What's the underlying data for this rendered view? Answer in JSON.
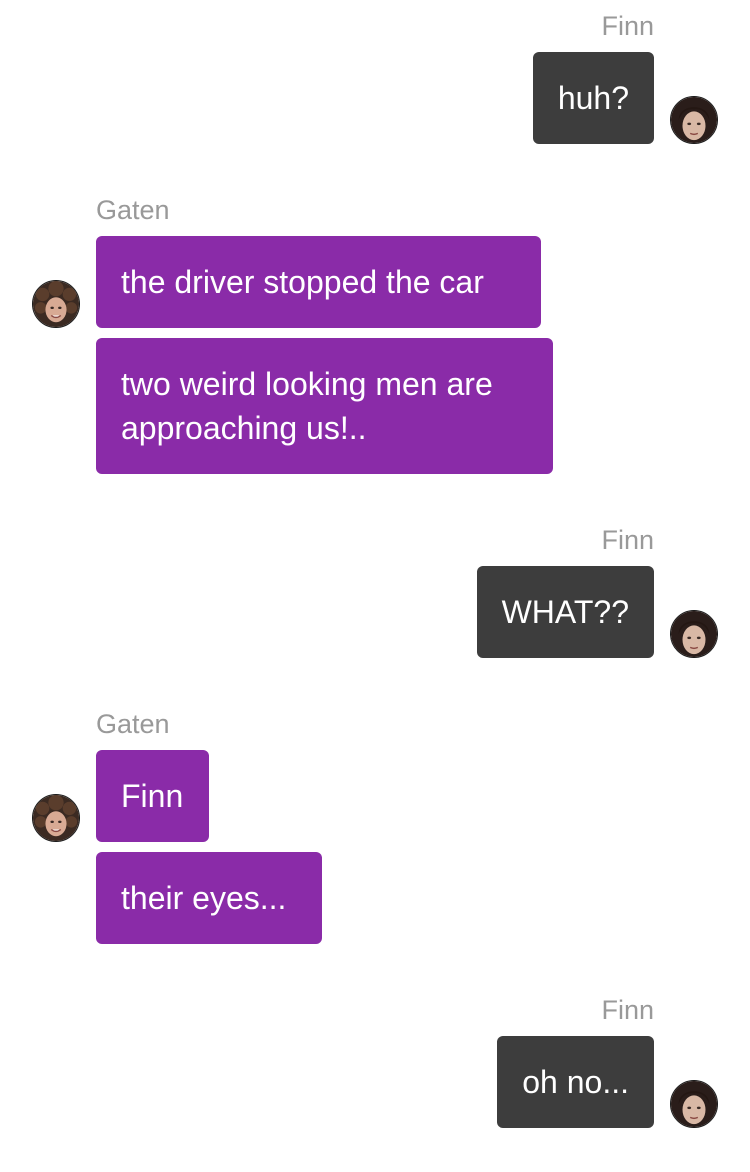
{
  "conversation": {
    "block1": {
      "sender": "Finn",
      "messages": [
        "huh?"
      ]
    },
    "block2": {
      "sender": "Gaten",
      "messages": [
        "the driver stopped the car",
        "two weird looking men are approaching us!.."
      ]
    },
    "block3": {
      "sender": "Finn",
      "messages": [
        "WHAT??"
      ]
    },
    "block4": {
      "sender": "Gaten",
      "messages": [
        "Finn",
        "their eyes..."
      ]
    },
    "block5": {
      "sender": "Finn",
      "messages": [
        "oh no..."
      ]
    }
  },
  "avatars": {
    "finn": "finn-avatar-icon",
    "gaten": "gaten-avatar-icon"
  },
  "colors": {
    "outgoing_bubble": "#3d3d3d",
    "incoming_bubble": "#8a2ba8",
    "sender_name": "#999999",
    "background": "#ffffff"
  }
}
